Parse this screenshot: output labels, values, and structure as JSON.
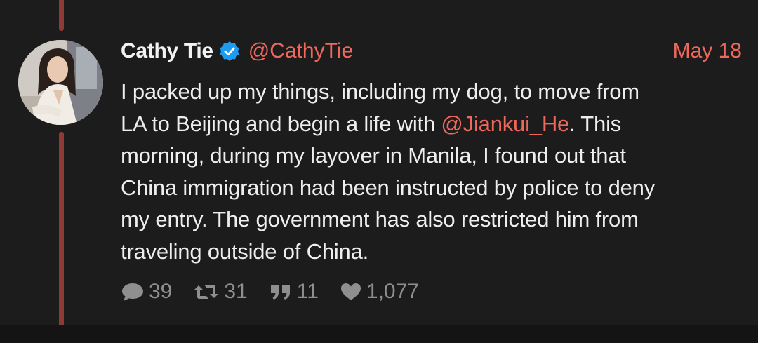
{
  "tweet": {
    "author_name": "Cathy Tie",
    "handle": "@CathyTie",
    "date": "May 18",
    "text_lines": [
      [
        "I packed up my things, including my dog, to move from"
      ],
      [
        "LA to Beijing and begin a life with ",
        "@Jiankui_He",
        ". This"
      ],
      [
        "morning, during my layover in Manila, I found out that"
      ],
      [
        "China immigration had been instructed by police to deny"
      ],
      [
        "my entry. The government has also restricted him from"
      ],
      [
        "traveling outside of China."
      ]
    ],
    "mention": "@Jiankui_He"
  },
  "actions": {
    "replies": "39",
    "retweets": "31",
    "quotes": "11",
    "likes": "1,077"
  },
  "icons": {
    "verified": "verified-badge-icon",
    "reply": "speech-bubble-icon",
    "retweet": "retweet-icon",
    "quote": "quote-icon",
    "like": "heart-icon"
  },
  "colors": {
    "background": "#1c1c1c",
    "accent": "#f0685c",
    "thread_line": "#8e3b37",
    "verified": "#1d9bf0",
    "muted": "#8f8f8f"
  }
}
